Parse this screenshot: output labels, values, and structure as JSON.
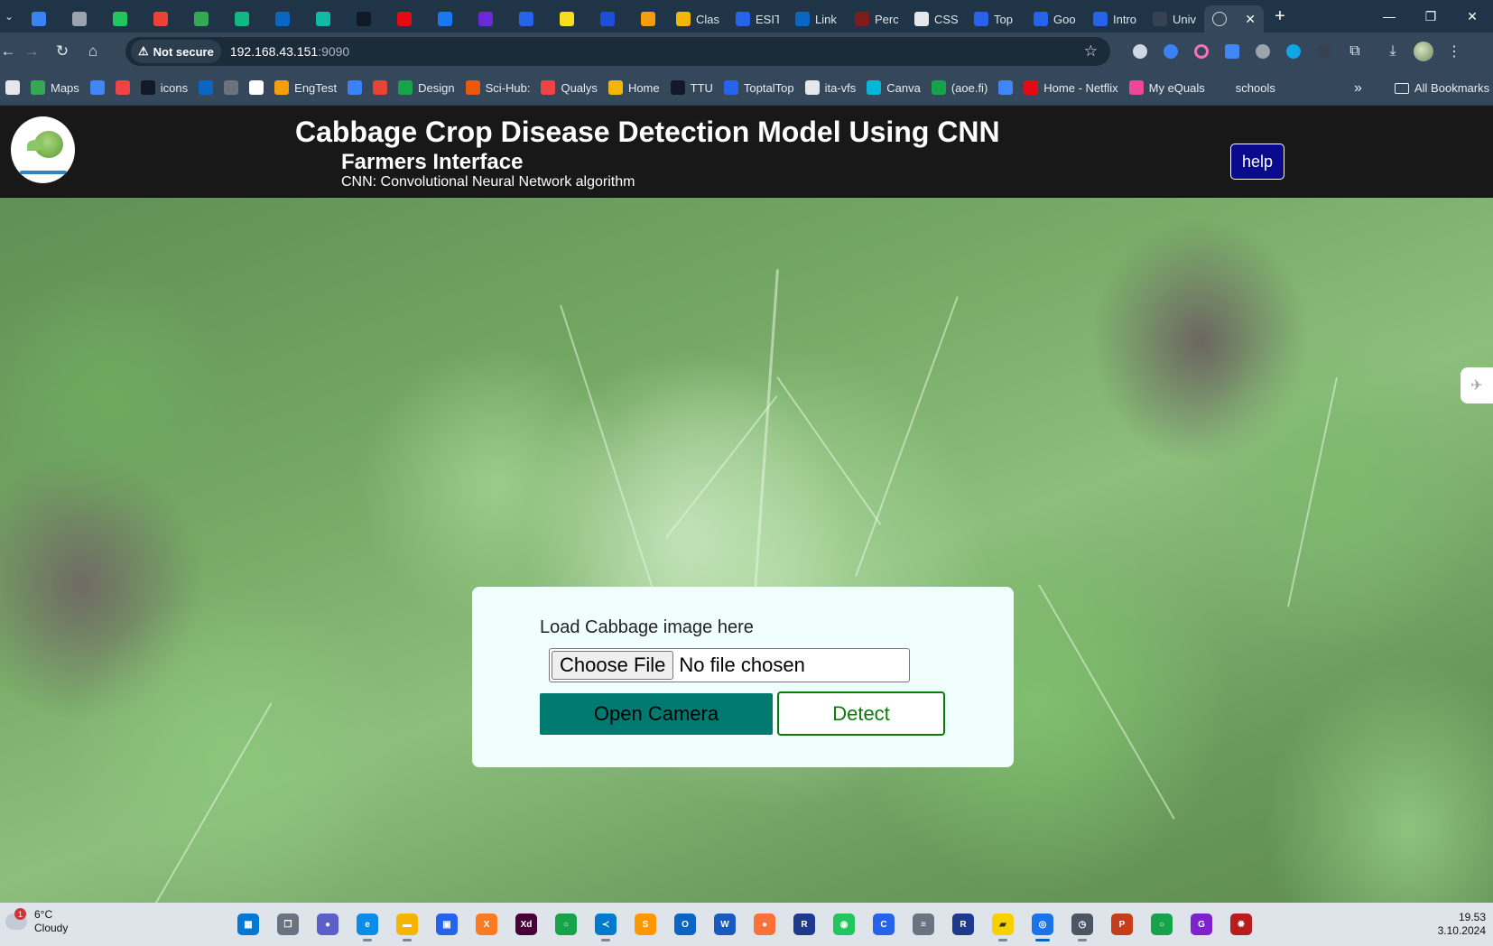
{
  "browser": {
    "tabs": [
      {
        "label": "",
        "icon": "maps-pin-icon",
        "color": "#3b82f6"
      },
      {
        "label": "",
        "icon": "gear-tab-icon",
        "color": "#9ca3af"
      },
      {
        "label": "",
        "icon": "whatsapp-icon",
        "color": "#22c55e"
      },
      {
        "label": "",
        "icon": "gmail-icon",
        "color": "#ea4335"
      },
      {
        "label": "",
        "icon": "google-maps-icon",
        "color": "#34a853"
      },
      {
        "label": "",
        "icon": "meet-icon",
        "color": "#10b981"
      },
      {
        "label": "",
        "icon": "linkedin-icon",
        "color": "#0a66c2"
      },
      {
        "label": "",
        "icon": "shield-heart-icon",
        "color": "#14b8a6"
      },
      {
        "label": "",
        "icon": "upwork-icon",
        "color": "#111827"
      },
      {
        "label": "",
        "icon": "netflix-icon",
        "color": "#e50914"
      },
      {
        "label": "",
        "icon": "facebook-icon",
        "color": "#1877f2"
      },
      {
        "label": "",
        "icon": "purple-circle-icon",
        "color": "#6d28d9"
      },
      {
        "label": "",
        "icon": "sql-icon",
        "color": "#2563eb"
      },
      {
        "label": "",
        "icon": "js-icon",
        "color": "#f7df1e"
      },
      {
        "label": "",
        "icon": "notion-icon",
        "color": "#1d4ed8"
      },
      {
        "label": "",
        "icon": "pinwheel-icon",
        "color": "#f59e0b"
      },
      {
        "label": "Clas",
        "icon": "classroom-icon",
        "color": "#f2b705"
      },
      {
        "label": "ESIT",
        "icon": "portrait-icon",
        "color": "#2563eb"
      },
      {
        "label": "Link",
        "icon": "linkedin-icon",
        "color": "#0a66c2"
      },
      {
        "label": "Perc",
        "icon": "percipio-icon",
        "color": "#7f1d1d"
      },
      {
        "label": "CSS",
        "icon": "grid-icon",
        "color": "#e5e7eb"
      },
      {
        "label": "Top",
        "icon": "c-logo-icon",
        "color": "#2563eb"
      },
      {
        "label": "Goo",
        "icon": "c-logo-icon",
        "color": "#2563eb"
      },
      {
        "label": "Intro",
        "icon": "c-logo-icon",
        "color": "#2563eb"
      },
      {
        "label": "Univ",
        "icon": "dark-circle-icon",
        "color": "#374151"
      }
    ],
    "active_tab": {
      "label": "",
      "icon": "globe-icon"
    },
    "new_tab": "+",
    "tab_menu_icon": "⌄",
    "controls": {
      "minimize": "—",
      "restore": "❐",
      "close": "✕"
    },
    "security_label": "Not secure",
    "url_host": "192.168.43.151",
    "url_port": ":9090",
    "bookmarks": [
      {
        "label": "",
        "icon": "checkbox-icon",
        "color": "#e5e7eb"
      },
      {
        "label": "Maps",
        "icon": "maps-pin-icon",
        "color": "#34a853"
      },
      {
        "label": "",
        "icon": "translate-icon",
        "color": "#4285f4"
      },
      {
        "label": "",
        "icon": "pinwheel-icon",
        "color": "#ef4444"
      },
      {
        "label": "icons",
        "icon": "icons8-icon",
        "color": "#111827"
      },
      {
        "label": "",
        "icon": "linkedin-icon",
        "color": "#0a66c2"
      },
      {
        "label": "",
        "icon": "chatgpt-icon",
        "color": "#6b7280"
      },
      {
        "label": "",
        "icon": "google-icon",
        "color": "#ffffff"
      },
      {
        "label": "EngTest",
        "icon": "sun-icon",
        "color": "#f59e0b"
      },
      {
        "label": "",
        "icon": "drop-icon",
        "color": "#3b82f6"
      },
      {
        "label": "",
        "icon": "gmail-icon",
        "color": "#ea4335"
      },
      {
        "label": "Design",
        "icon": "figure-icon",
        "color": "#16a34a"
      },
      {
        "label": "Sci-Hub:",
        "icon": "raven-icon",
        "color": "#ea580c"
      },
      {
        "label": "Qualys",
        "icon": "qualys-icon",
        "color": "#ef4444"
      },
      {
        "label": "Home",
        "icon": "classroom-icon",
        "color": "#f2b705"
      },
      {
        "label": "TTU",
        "icon": "triangle-icon",
        "color": "#111827"
      },
      {
        "label": "ToptalTop",
        "icon": "toptal-icon",
        "color": "#2563eb"
      },
      {
        "label": "ita-vfs",
        "icon": "ita-icon",
        "color": "#e5e7eb"
      },
      {
        "label": "Canva",
        "icon": "canva-icon",
        "color": "#06b6d4"
      },
      {
        "label": "(aoe.fi)",
        "icon": "play-circle-icon",
        "color": "#16a34a"
      },
      {
        "label": "",
        "icon": "docs-icon",
        "color": "#4285f4"
      },
      {
        "label": "Home - Netflix",
        "icon": "netflix-icon",
        "color": "#e50914"
      },
      {
        "label": "My eQuals",
        "icon": "person-icon",
        "color": "#ec4899"
      },
      {
        "label": "schools",
        "icon": "folder-icon",
        "color": "#35475a"
      }
    ],
    "more_bookmarks": "»",
    "all_bookmarks": "All Bookmarks"
  },
  "header": {
    "title": "Cabbage Crop Disease Detection Model Using CNN",
    "subtitle": "Farmers Interface",
    "tagline": "CNN: Convolutional Neural Network algorithm",
    "help_label": "help"
  },
  "upload": {
    "label": "Load Cabbage image here",
    "choose_file": "Choose File",
    "file_status": "No file chosen",
    "open_camera": "Open Camera",
    "detect": "Detect"
  },
  "taskbar": {
    "temperature": "6°C",
    "condition": "Cloudy",
    "notification_count": "1",
    "time": "19.53",
    "date": "3.10.2024",
    "apps": [
      {
        "name": "start",
        "color": "#0078d4",
        "glyph": "▦"
      },
      {
        "name": "task-view",
        "color": "#6b7280",
        "glyph": "❐"
      },
      {
        "name": "meet-now",
        "color": "#5b5fc7",
        "glyph": "●"
      },
      {
        "name": "edge",
        "color": "#0c8ce9",
        "glyph": "e"
      },
      {
        "name": "file-explorer",
        "color": "#f4b400",
        "glyph": "▬"
      },
      {
        "name": "store",
        "color": "#2563eb",
        "glyph": "▣"
      },
      {
        "name": "xampp",
        "color": "#fb7a24",
        "glyph": "X"
      },
      {
        "name": "adobe-xd",
        "color": "#470137",
        "glyph": "Xd"
      },
      {
        "name": "circle-app",
        "color": "#16a34a",
        "glyph": "○"
      },
      {
        "name": "vscode",
        "color": "#007acc",
        "glyph": "≺"
      },
      {
        "name": "sublime",
        "color": "#ff9800",
        "glyph": "S"
      },
      {
        "name": "outlook",
        "color": "#0a64c2",
        "glyph": "O"
      },
      {
        "name": "word",
        "color": "#185abd",
        "glyph": "W"
      },
      {
        "name": "firefox",
        "color": "#ff7139",
        "glyph": "●"
      },
      {
        "name": "remote-app",
        "color": "#1e3a8a",
        "glyph": "R"
      },
      {
        "name": "owl-app",
        "color": "#22c55e",
        "glyph": "◉"
      },
      {
        "name": "c-app",
        "color": "#2563eb",
        "glyph": "C"
      },
      {
        "name": "cisco",
        "color": "#6b7280",
        "glyph": "≡"
      },
      {
        "name": "remote-app-2",
        "color": "#1e3a8a",
        "glyph": "R"
      },
      {
        "name": "sticky-notes",
        "color": "#f7d000",
        "glyph": "▰"
      },
      {
        "name": "chrome",
        "color": "#1a73e8",
        "glyph": "◎"
      },
      {
        "name": "clock-app",
        "color": "#4b5563",
        "glyph": "◷"
      },
      {
        "name": "powerpoint",
        "color": "#c43e1c",
        "glyph": "P"
      },
      {
        "name": "ring-app",
        "color": "#16a34a",
        "glyph": "○"
      },
      {
        "name": "purple-app",
        "color": "#7e22ce",
        "glyph": "G"
      },
      {
        "name": "gear-app",
        "color": "#b91c1c",
        "glyph": "✹"
      }
    ]
  }
}
